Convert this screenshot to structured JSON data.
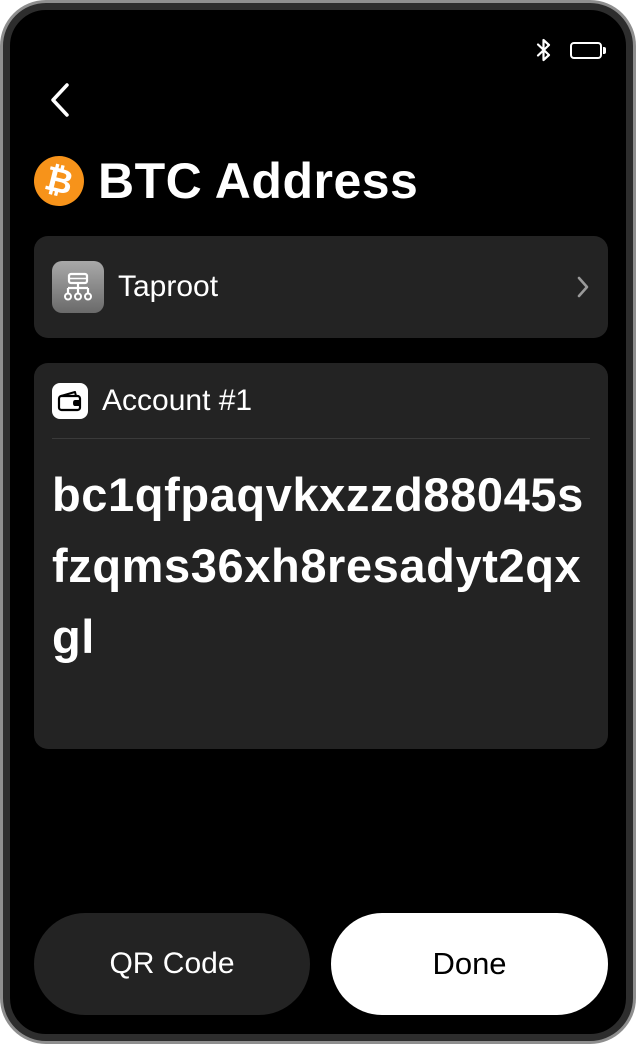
{
  "status_bar": {
    "bluetooth_icon": "bluetooth-icon",
    "battery_icon": "battery-full-icon"
  },
  "header": {
    "back_icon": "chevron-left-icon",
    "coin_symbol": "₿",
    "title": "BTC Address"
  },
  "address_type": {
    "icon": "hierarchy-icon",
    "label": "Taproot",
    "chevron_icon": "chevron-right-icon"
  },
  "account": {
    "icon": "wallet-icon",
    "label": "Account #1",
    "address": "bc1qfpaqvkxzzd88045sfzqms36xh8resadyt2qxgl"
  },
  "actions": {
    "qr_label": "QR Code",
    "done_label": "Done"
  },
  "colors": {
    "background": "#000000",
    "card": "#232323",
    "bitcoin_orange": "#f7931a",
    "text": "#ffffff"
  }
}
